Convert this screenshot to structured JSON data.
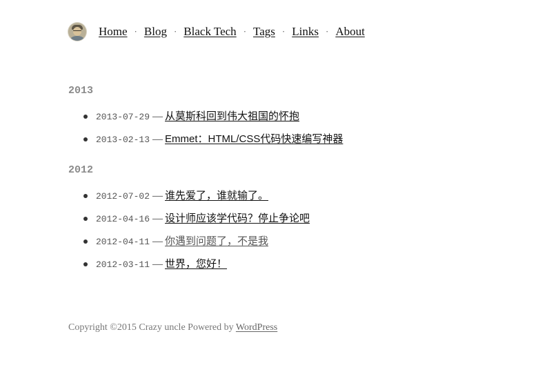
{
  "nav": {
    "items": [
      {
        "label": "Home"
      },
      {
        "label": "Blog"
      },
      {
        "label": "Black Tech"
      },
      {
        "label": "Tags"
      },
      {
        "label": "Links"
      },
      {
        "label": "About"
      }
    ],
    "separator": "·"
  },
  "archive": {
    "dash": "—",
    "years": [
      {
        "year": "2013",
        "posts": [
          {
            "date": "2013-07-29",
            "title": "从莫斯科回到伟大祖国的怀抱"
          },
          {
            "date": "2013-02-13",
            "title": "Emmet：HTML/CSS代码快速编写神器"
          }
        ]
      },
      {
        "year": "2012",
        "posts": [
          {
            "date": "2012-07-02",
            "title": "谁先爱了，谁就输了。"
          },
          {
            "date": "2012-04-16",
            "title": "设计师应该学代码？停止争论吧"
          },
          {
            "date": "2012-04-11",
            "title": "你遇到问题了，不是我"
          },
          {
            "date": "2012-03-11",
            "title": "世界，您好！"
          }
        ]
      }
    ]
  },
  "footer": {
    "text": "Copyright ©2015 Crazy uncle Powered by ",
    "link_label": "WordPress"
  }
}
